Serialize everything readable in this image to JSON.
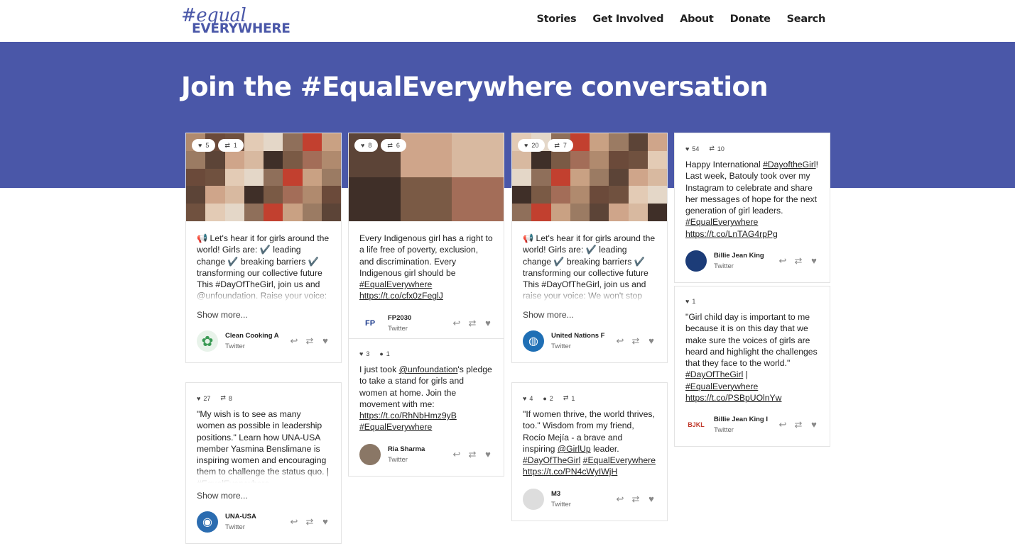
{
  "header": {
    "logo_tag": "#equal",
    "logo_word": "EVERYWHERE",
    "nav": [
      "Stories",
      "Get Involved",
      "About",
      "Donate",
      "Search"
    ]
  },
  "hero": {
    "title": "Join the #EqualEverywhere conversation"
  },
  "icons": {
    "heart": "heart-icon",
    "retweet": "retweet-icon",
    "reply": "reply-icon",
    "comment": "comment-icon"
  },
  "cards": {
    "c1": {
      "likes": "5",
      "retweets": "1",
      "text": "📢 Let's hear it for girls around the world! Girls are: ✔️ leading change ✔️ breaking barriers ✔️ transforming our collective future This #DayOfTheGirl, join us and @unfoundation. Raise your voice: We won't stop until girls are #EqualEvery-",
      "more": "Show more...",
      "name": "Clean Cooking A",
      "platform": "Twitter"
    },
    "c2": {
      "likes": "27",
      "retweets": "8",
      "text": "\"My wish is to see as many women as possible in leadership positions.\" Learn how UNA-USA member Yasmina Benslimane is inspiring women and encouraging them to challenge the status quo. | #EqualEverywhere @unfoundation",
      "more": "Show more...",
      "name": "UNA-USA",
      "platform": "Twitter"
    },
    "c3": {
      "likes": "8",
      "retweets": "6",
      "text": "Every Indigenous girl has a right to a life free of poverty, exclusion, and discrimination. Every Indigenous girl should be",
      "tag": "#EqualEverywhere",
      "link": "https://t.co/cfx0zFeglJ",
      "name": "FP2030",
      "platform": "Twitter"
    },
    "c4": {
      "likes": "3",
      "comments": "1",
      "pre": "I just took",
      "mention": "@unfoundation",
      "mid": "'s pledge to take a stand for girls and women at home. Join the movement with me:",
      "link": "https://t.co/RhNbHmz9yB",
      "tag": "#EqualEverywhere",
      "name": "Ria Sharma",
      "platform": "Twitter"
    },
    "c5": {
      "likes": "20",
      "retweets": "7",
      "text": "📢 Let's hear it for girls around the world! Girls are: ✔️ leading change ✔️ breaking barriers ✔️ transforming our collective future This #DayOfTheGirl, join us and raise your voice: We won't stop until girls are #EqualEverywhere. →",
      "more": "Show more...",
      "name": "United Nations F",
      "platform": "Twitter"
    },
    "c6": {
      "likes": "4",
      "comments": "2",
      "retweets": "1",
      "text": "\"If women thrive, the world thrives, too.\" Wisdom from my friend, Rocío Mejía - a brave and inspiring",
      "mention": "@GirlUp",
      "rest": "leader.",
      "tag1": "#DayOfTheGirl",
      "tag2": "#EqualEverywhere",
      "link": "https://t.co/PN4cWyIWjH",
      "name": "M3",
      "platform": "Twitter"
    },
    "c7": {
      "likes": "54",
      "retweets": "10",
      "pre": "Happy International",
      "tag1": "#DayoftheGirl",
      "mid": "! Last week, Batouly took over my Instagram to celebrate and share her messages of hope for the next generation of girl leaders.",
      "tag2": "#EqualEverywhere",
      "link": "https://t.co/LnTAG4rpPg",
      "name": "Billie Jean King",
      "platform": "Twitter"
    },
    "c8": {
      "likes": "1",
      "text": "\"Girl child day is important to me because it is on this day that we make sure the voices of girls are heard and highlight the challenges that they face to the world.\"",
      "tag1": "#DayOfTheGirl",
      "sep": "|",
      "tag2": "#EqualEverywhere",
      "link": "https://t.co/PSBpUOlnYw",
      "name": "Billie Jean King I",
      "platform": "Twitter",
      "logo_text": "BJKL"
    }
  }
}
